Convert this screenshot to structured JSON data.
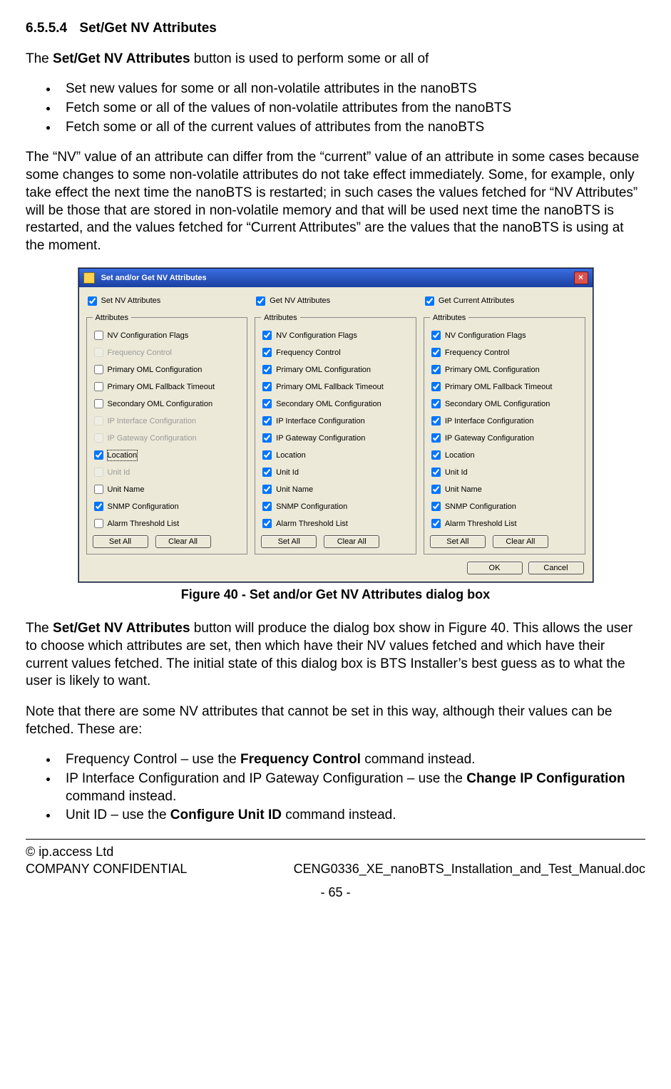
{
  "heading_num": "6.5.5.4",
  "heading_title": "Set/Get NV Attributes",
  "para1_a": "The ",
  "para1_b": "Set/Get NV Attributes",
  "para1_c": " button is used to perform some or all of",
  "bullets1": [
    "Set new values for some or all non-volatile attributes in the nanoBTS",
    "Fetch some or all of the values of non-volatile attributes from the nanoBTS",
    "Fetch some or all of the current values of attributes from the nanoBTS"
  ],
  "para2": "The “NV” value of an attribute can differ from the “current” value of an attribute in some cases because some changes to some non-volatile attributes do not take effect immediately. Some, for example, only take effect the next time the nanoBTS is restarted; in such cases the values fetched for “NV Attributes” will be those that are stored in non-volatile memory and that will be used next time the nanoBTS is restarted, and the values fetched for “Current Attributes” are the values that the nanoBTS is using at the moment.",
  "dialog": {
    "title": "Set and/or Get NV Attributes",
    "legend": "Attributes",
    "set_all": "Set All",
    "clear_all": "Clear All",
    "ok": "OK",
    "cancel": "Cancel",
    "columns": [
      {
        "header_label": "Set NV Attributes",
        "header_checked": true,
        "items": [
          {
            "label": "NV Configuration Flags",
            "checked": false,
            "disabled": false
          },
          {
            "label": "Frequency Control",
            "checked": false,
            "disabled": true
          },
          {
            "label": "Primary OML Configuration",
            "checked": false,
            "disabled": false
          },
          {
            "label": "Primary OML Fallback Timeout",
            "checked": false,
            "disabled": false
          },
          {
            "label": "Secondary OML Configuration",
            "checked": false,
            "disabled": false
          },
          {
            "label": "IP Interface Configuration",
            "checked": false,
            "disabled": true
          },
          {
            "label": "IP Gateway Configuration",
            "checked": false,
            "disabled": true
          },
          {
            "label": "Location",
            "checked": true,
            "disabled": false,
            "focus": true
          },
          {
            "label": "Unit Id",
            "checked": false,
            "disabled": true
          },
          {
            "label": "Unit Name",
            "checked": false,
            "disabled": false
          },
          {
            "label": "SNMP Configuration",
            "checked": true,
            "disabled": false
          },
          {
            "label": "Alarm Threshold List",
            "checked": false,
            "disabled": false
          }
        ]
      },
      {
        "header_label": "Get NV Attributes",
        "header_checked": true,
        "items": [
          {
            "label": "NV Configuration Flags",
            "checked": true
          },
          {
            "label": "Frequency Control",
            "checked": true
          },
          {
            "label": "Primary OML Configuration",
            "checked": true
          },
          {
            "label": "Primary OML Fallback Timeout",
            "checked": true
          },
          {
            "label": "Secondary OML Configuration",
            "checked": true
          },
          {
            "label": "IP Interface Configuration",
            "checked": true
          },
          {
            "label": "IP Gateway Configuration",
            "checked": true
          },
          {
            "label": "Location",
            "checked": true
          },
          {
            "label": "Unit Id",
            "checked": true
          },
          {
            "label": "Unit Name",
            "checked": true
          },
          {
            "label": "SNMP Configuration",
            "checked": true
          },
          {
            "label": "Alarm Threshold List",
            "checked": true
          }
        ]
      },
      {
        "header_label": "Get Current Attributes",
        "header_checked": true,
        "items": [
          {
            "label": "NV Configuration Flags",
            "checked": true
          },
          {
            "label": "Frequency Control",
            "checked": true
          },
          {
            "label": "Primary OML Configuration",
            "checked": true
          },
          {
            "label": "Primary OML Fallback Timeout",
            "checked": true
          },
          {
            "label": "Secondary OML Configuration",
            "checked": true
          },
          {
            "label": "IP Interface Configuration",
            "checked": true
          },
          {
            "label": "IP Gateway Configuration",
            "checked": true
          },
          {
            "label": "Location",
            "checked": true
          },
          {
            "label": "Unit Id",
            "checked": true
          },
          {
            "label": "Unit Name",
            "checked": true
          },
          {
            "label": "SNMP Configuration",
            "checked": true
          },
          {
            "label": "Alarm Threshold List",
            "checked": true
          }
        ]
      }
    ]
  },
  "figure_caption": "Figure 40 - Set and/or Get NV Attributes dialog box",
  "para3_a": "The ",
  "para3_b": "Set/Get NV Attributes",
  "para3_c": " button will produce the dialog box show in Figure 40. This allows the user to choose which attributes are set, then which have their NV values fetched and which have their current values fetched. The initial state of this dialog box is BTS Installer’s best guess as to what the user is likely to want.",
  "para4": "Note that there are some NV attributes that cannot be set in this way, although their values can be fetched. These are:",
  "bullets2": [
    {
      "pre": "Frequency Control – use the ",
      "bold": "Frequency Control",
      "post": " command instead."
    },
    {
      "pre": "IP Interface Configuration and IP Gateway Configuration – use the ",
      "bold": "Change IP Configuration",
      "post": " command instead."
    },
    {
      "pre": "Unit ID – use the ",
      "bold": "Configure Unit ID",
      "post": " command instead."
    }
  ],
  "footer": {
    "copyright": "© ip.access Ltd",
    "conf": "COMPANY CONFIDENTIAL",
    "doc": "CENG0336_XE_nanoBTS_Installation_and_Test_Manual.doc",
    "page": "- 65 -"
  }
}
